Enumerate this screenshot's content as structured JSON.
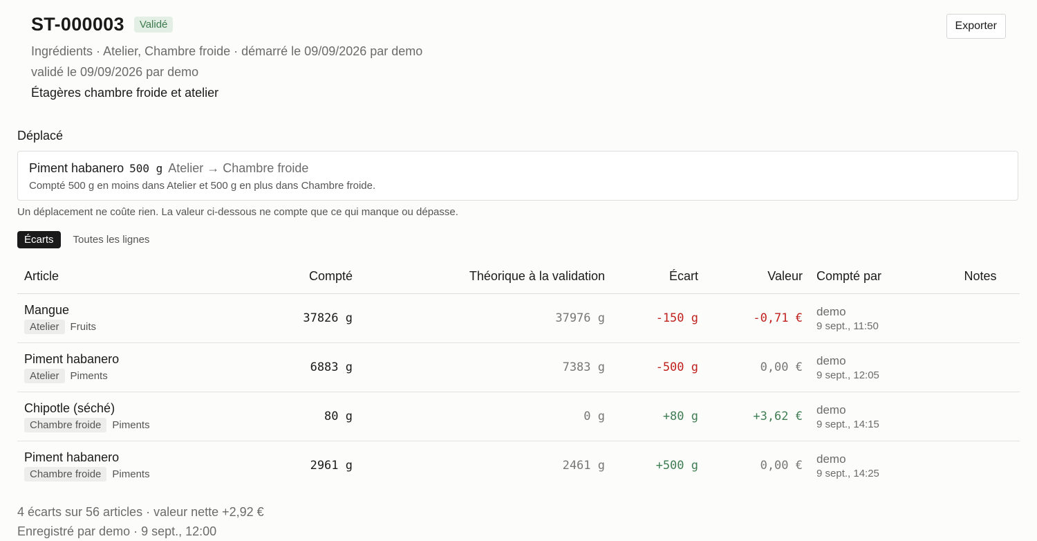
{
  "header": {
    "title": "ST-000003",
    "status_badge": "Validé",
    "meta_line1": "Ingrédients · Atelier, Chambre froide · démarré le 09/09/2026 par demo",
    "meta_line2": "validé le 09/09/2026 par demo",
    "description": "Étagères chambre froide et atelier",
    "export_label": "Exporter"
  },
  "moved": {
    "section_title": "Déplacé",
    "item_name": "Piment habanero",
    "qty": "500 g",
    "route": "Atelier → Chambre froide",
    "detail": "Compté 500 g en moins dans Atelier et 500 g en plus dans Chambre froide.",
    "note": "Un déplacement ne coûte rien. La valeur ci-dessous ne compte que ce qui manque ou dépasse."
  },
  "tabs": [
    {
      "label": "Écarts",
      "active": true
    },
    {
      "label": "Toutes les lignes",
      "active": false
    }
  ],
  "table": {
    "columns": {
      "article": "Article",
      "counted": "Compté",
      "theoretical": "Théorique à la validation",
      "diff": "Écart",
      "value": "Valeur",
      "counted_by": "Compté par",
      "notes": "Notes"
    },
    "rows": [
      {
        "name": "Mangue",
        "location": "Atelier",
        "category": "Fruits",
        "counted": "37826 g",
        "theoretical": "37976 g",
        "diff": "-150 g",
        "value": "-0,71 €",
        "by": "demo",
        "time": "9 sept., 11:50",
        "diff_sign": "neg",
        "value_sign": "neg",
        "notes": ""
      },
      {
        "name": "Piment habanero",
        "location": "Atelier",
        "category": "Piments",
        "counted": "6883 g",
        "theoretical": "7383 g",
        "diff": "-500 g",
        "value": "0,00 €",
        "by": "demo",
        "time": "9 sept., 12:05",
        "diff_sign": "neg",
        "value_sign": "zero",
        "notes": ""
      },
      {
        "name": "Chipotle (séché)",
        "location": "Chambre froide",
        "category": "Piments",
        "counted": "80 g",
        "theoretical": "0 g",
        "diff": "+80 g",
        "value": "+3,62 €",
        "by": "demo",
        "time": "9 sept., 14:15",
        "diff_sign": "pos",
        "value_sign": "pos",
        "notes": ""
      },
      {
        "name": "Piment habanero",
        "location": "Chambre froide",
        "category": "Piments",
        "counted": "2961 g",
        "theoretical": "2461 g",
        "diff": "+500 g",
        "value": "0,00 €",
        "by": "demo",
        "time": "9 sept., 14:25",
        "diff_sign": "pos",
        "value_sign": "zero",
        "notes": ""
      }
    ]
  },
  "footer": {
    "summary": "4 écarts sur 56 articles · valeur nette +2,92 €",
    "recorded": "Enregistré par demo · 9 sept., 12:00"
  },
  "colors": {
    "negative": "#c0211d",
    "positive": "#3f7d52",
    "badge_bg": "#e3efe5",
    "badge_text": "#3e7a4d"
  }
}
